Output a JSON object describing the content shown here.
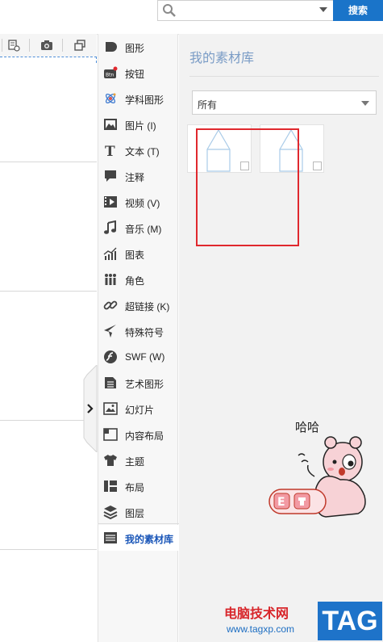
{
  "search": {
    "value": "",
    "button_label": "搜索"
  },
  "sidebar": {
    "items": [
      {
        "label": "图形",
        "icon": "shape-icon"
      },
      {
        "label": "按钮",
        "icon": "button-icon"
      },
      {
        "label": "学科图形",
        "icon": "atom-icon"
      },
      {
        "label": "图片 (I)",
        "icon": "image-icon"
      },
      {
        "label": "文本 (T)",
        "icon": "text-icon"
      },
      {
        "label": "注释",
        "icon": "comment-icon"
      },
      {
        "label": "视频 (V)",
        "icon": "video-icon"
      },
      {
        "label": "音乐 (M)",
        "icon": "music-icon"
      },
      {
        "label": "图表",
        "icon": "chart-icon"
      },
      {
        "label": "角色",
        "icon": "people-icon"
      },
      {
        "label": "超链接 (K)",
        "icon": "link-icon"
      },
      {
        "label": "特殊符号",
        "icon": "airplane-icon"
      },
      {
        "label": "SWF (W)",
        "icon": "flash-icon"
      },
      {
        "label": "艺术图形",
        "icon": "art-icon"
      },
      {
        "label": "幻灯片",
        "icon": "slide-icon"
      },
      {
        "label": "内容布局",
        "icon": "layout-icon"
      },
      {
        "label": "主题",
        "icon": "shirt-icon"
      },
      {
        "label": "布局",
        "icon": "grid-layout-icon"
      },
      {
        "label": "图层",
        "icon": "layers-icon"
      },
      {
        "label": "我的素材库",
        "icon": "library-icon"
      }
    ],
    "active_index": 19,
    "button_badge_color": "#e0282e"
  },
  "panel": {
    "title": "我的素材库",
    "filter_value": "所有",
    "thumbnail_count": 2
  },
  "decor": {
    "mascot_text": "哈哈",
    "mascot_sign": "E",
    "watermark_text": "电脑技术网",
    "watermark_url": "www.tagxp.com",
    "tag_label": "TAG"
  },
  "colors": {
    "accent": "#1a74c9",
    "highlight": "#e0282e",
    "panel_title": "#7a9cc6"
  }
}
